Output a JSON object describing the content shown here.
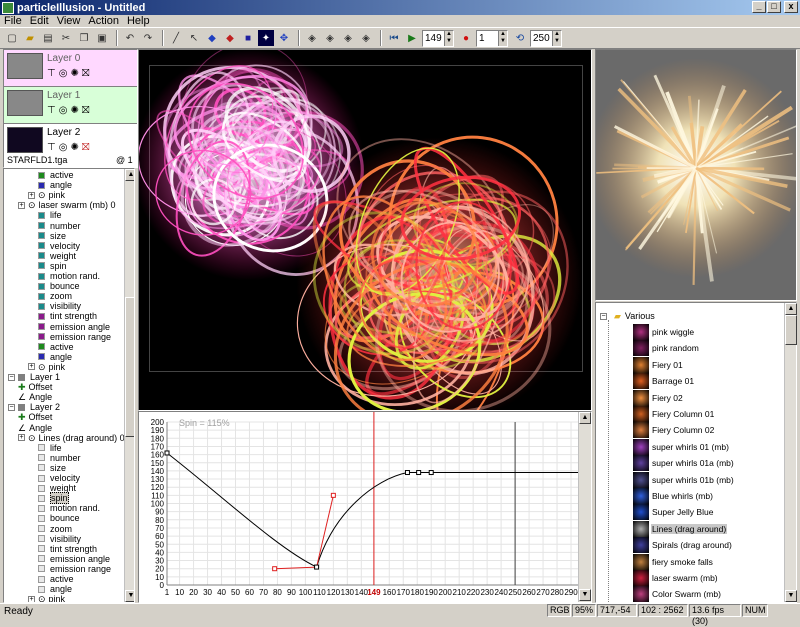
{
  "window": {
    "title": "particleIllusion - Untitled",
    "minimize": "_",
    "maximize": "□",
    "close": "x"
  },
  "menu": [
    "File",
    "Edit",
    "View",
    "Action",
    "Help"
  ],
  "toolbar": {
    "frame_value": "149",
    "record_value": "1",
    "end_value": "250"
  },
  "layers": [
    {
      "name": "Layer 0",
      "bg": "#ffd8ff"
    },
    {
      "name": "Layer 1",
      "bg": "#d8ffd8"
    },
    {
      "name": "Layer 2",
      "bg": "#ffffff"
    }
  ],
  "layer_file": {
    "name": "STARFLD1.tga",
    "count": "@ 1"
  },
  "tree": [
    {
      "indent": 3,
      "label": "active",
      "color": "#1e8a1e",
      "type": "sq"
    },
    {
      "indent": 3,
      "label": "angle",
      "color": "#2a2ab0",
      "type": "sq"
    },
    {
      "indent": 2,
      "label": "pink",
      "color": "",
      "type": "node"
    },
    {
      "indent": 1,
      "label": "laser swarm (mb) 0",
      "color": "",
      "type": "node"
    },
    {
      "indent": 3,
      "label": "life",
      "color": "#1a8a8a",
      "type": "sq"
    },
    {
      "indent": 3,
      "label": "number",
      "color": "#1a8a8a",
      "type": "sq"
    },
    {
      "indent": 3,
      "label": "size",
      "color": "#1a8a8a",
      "type": "sq"
    },
    {
      "indent": 3,
      "label": "velocity",
      "color": "#1a8a8a",
      "type": "sq"
    },
    {
      "indent": 3,
      "label": "weight",
      "color": "#1a8a8a",
      "type": "sq"
    },
    {
      "indent": 3,
      "label": "spin",
      "color": "#1a8a8a",
      "type": "sq"
    },
    {
      "indent": 3,
      "label": "motion rand.",
      "color": "#1a8a8a",
      "type": "sq"
    },
    {
      "indent": 3,
      "label": "bounce",
      "color": "#1a8a8a",
      "type": "sq"
    },
    {
      "indent": 3,
      "label": "zoom",
      "color": "#1a8a8a",
      "type": "sq"
    },
    {
      "indent": 3,
      "label": "visibility",
      "color": "#1a8a8a",
      "type": "sq"
    },
    {
      "indent": 3,
      "label": "tint strength",
      "color": "#8a1a8a",
      "type": "sq"
    },
    {
      "indent": 3,
      "label": "emission angle",
      "color": "#8a1a8a",
      "type": "sq"
    },
    {
      "indent": 3,
      "label": "emission range",
      "color": "#8a1a8a",
      "type": "sq"
    },
    {
      "indent": 3,
      "label": "active",
      "color": "#1e8a1e",
      "type": "sq"
    },
    {
      "indent": 3,
      "label": "angle",
      "color": "#2a2ab0",
      "type": "sq"
    },
    {
      "indent": 2,
      "label": "pink",
      "color": "",
      "type": "node"
    },
    {
      "indent": 0,
      "label": "Layer 1",
      "color": "#808080",
      "type": "layer"
    },
    {
      "indent": 1,
      "label": "Offset",
      "color": "",
      "type": "cross"
    },
    {
      "indent": 1,
      "label": "Angle",
      "color": "",
      "type": "angle"
    },
    {
      "indent": 0,
      "label": "Layer 2",
      "color": "#808080",
      "type": "layer"
    },
    {
      "indent": 1,
      "label": "Offset",
      "color": "",
      "type": "cross"
    },
    {
      "indent": 1,
      "label": "Angle",
      "color": "",
      "type": "angle"
    },
    {
      "indent": 1,
      "label": "Lines (drag around) 0",
      "color": "",
      "type": "node"
    },
    {
      "indent": 3,
      "label": "life",
      "color": "#e8e8e8",
      "type": "sq"
    },
    {
      "indent": 3,
      "label": "number",
      "color": "#e8e8e8",
      "type": "sq"
    },
    {
      "indent": 3,
      "label": "size",
      "color": "#e8e8e8",
      "type": "sq"
    },
    {
      "indent": 3,
      "label": "velocity",
      "color": "#e8e8e8",
      "type": "sq"
    },
    {
      "indent": 3,
      "label": "weight",
      "color": "#e8e8e8",
      "type": "sq"
    },
    {
      "indent": 3,
      "label": "spin",
      "color": "#e8e8e8",
      "type": "sq",
      "selected": true
    },
    {
      "indent": 3,
      "label": "motion rand.",
      "color": "#e8e8e8",
      "type": "sq"
    },
    {
      "indent": 3,
      "label": "bounce",
      "color": "#e8e8e8",
      "type": "sq"
    },
    {
      "indent": 3,
      "label": "zoom",
      "color": "#e8e8e8",
      "type": "sq"
    },
    {
      "indent": 3,
      "label": "visibility",
      "color": "#e8e8e8",
      "type": "sq"
    },
    {
      "indent": 3,
      "label": "tint strength",
      "color": "#e8e8e8",
      "type": "sq"
    },
    {
      "indent": 3,
      "label": "emission angle",
      "color": "#e8e8e8",
      "type": "sq"
    },
    {
      "indent": 3,
      "label": "emission range",
      "color": "#e8e8e8",
      "type": "sq"
    },
    {
      "indent": 3,
      "label": "active",
      "color": "#e8e8e8",
      "type": "sq"
    },
    {
      "indent": 3,
      "label": "angle",
      "color": "#e8e8e8",
      "type": "sq"
    },
    {
      "indent": 2,
      "label": "pink",
      "color": "",
      "type": "node"
    }
  ],
  "graph": {
    "label": "Spin = 115%",
    "y_ticks": [
      "200",
      "190",
      "180",
      "170",
      "160",
      "150",
      "140",
      "130",
      "120",
      "110",
      "100",
      "90",
      "80",
      "70",
      "60",
      "50",
      "40",
      "30",
      "20",
      "10",
      "0"
    ],
    "x_ticks": [
      "1",
      "10",
      "20",
      "30",
      "40",
      "50",
      "60",
      "70",
      "80",
      "90",
      "100",
      "110",
      "120",
      "130",
      "140",
      "149",
      "160",
      "170",
      "180",
      "190",
      "200",
      "210",
      "220",
      "230",
      "240",
      "250",
      "260",
      "270",
      "280",
      "290",
      "300"
    ],
    "current_frame": "149"
  },
  "library": {
    "folder": "Various",
    "items": [
      "pink wiggle",
      "pink random",
      "Fiery 01",
      "Barrage 01",
      "Fiery 02",
      "Fiery Column 01",
      "Fiery Column 02",
      "super whirls 01 (mb)",
      "super whirls 01a (mb)",
      "super whirls 01b (mb)",
      "Blue whirls (mb)",
      "Super Jelly Blue",
      "Lines (drag around)",
      "Spirals (drag around)",
      "fiery smoke falls",
      "laser swarm (mb)",
      "Color Swarm (mb)"
    ],
    "selected": "Lines (drag around)",
    "thumb_colors": [
      "#b03080",
      "#802060",
      "#e08030",
      "#e06020",
      "#f09040",
      "#d06020",
      "#e08040",
      "#a040c0",
      "#6040a0",
      "#505090",
      "#3060e0",
      "#2050d0",
      "#b0b0b0",
      "#4040a0",
      "#c08040",
      "#d02040",
      "#c04080"
    ]
  },
  "status": {
    "ready": "Ready",
    "mode": "RGB",
    "zoom": "95%",
    "coords": "717,-54",
    "size": "102 : 2562",
    "fps": "13.6 fps (30)",
    "num": "NUM"
  }
}
